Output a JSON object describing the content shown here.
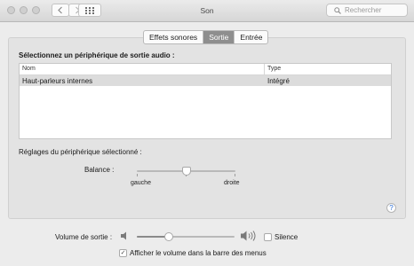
{
  "window": {
    "title": "Son",
    "search_placeholder": "Rechercher"
  },
  "tabs": [
    {
      "label": "Effets sonores",
      "selected": false
    },
    {
      "label": "Sortie",
      "selected": true
    },
    {
      "label": "Entrée",
      "selected": false
    }
  ],
  "output": {
    "heading": "Sélectionnez un périphérique de sortie audio :",
    "columns": [
      "Nom",
      "Type"
    ],
    "rows": [
      {
        "name": "Haut-parleurs internes",
        "type": "Intégré",
        "selected": true
      }
    ]
  },
  "device_settings": {
    "heading": "Réglages du périphérique sélectionné :",
    "balance_label": "Balance :",
    "left_label": "gauche",
    "right_label": "droite",
    "balance_value": 0.5
  },
  "volume": {
    "label": "Volume de sortie :",
    "value": 0.33,
    "mute_label": "Silence",
    "mute_checked": false,
    "menubar_label": "Afficher le volume dans la barre des menus",
    "menubar_checked": true
  },
  "icons": [
    "back-icon",
    "forward-icon",
    "grid-icon",
    "search-icon",
    "speaker-low-icon",
    "speaker-high-icon",
    "help-icon"
  ]
}
